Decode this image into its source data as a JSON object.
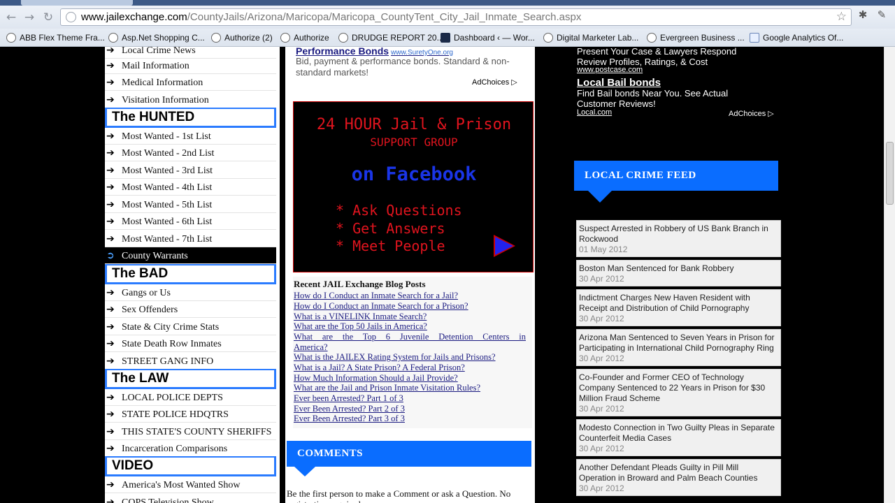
{
  "browser": {
    "url_domain": "www.jailexchange.com",
    "url_path": "/CountyJails/Arizona/Maricopa/Maricopa_CountyTent_City_Jail_Inmate_Search.aspx",
    "bookmarks": [
      {
        "label": "ABB Flex Theme Fra...",
        "icon": "circle-icon"
      },
      {
        "label": "Asp.Net Shopping C...",
        "icon": "circle-icon"
      },
      {
        "label": "Authorize (2)",
        "icon": "circle-icon"
      },
      {
        "label": "Authorize",
        "icon": "circle-icon"
      },
      {
        "label": "DRUDGE REPORT 20...",
        "icon": "circle-icon"
      },
      {
        "label": "Dashboard ‹ — Wor...",
        "icon": "x-square-icon"
      },
      {
        "label": "Digital Marketer Lab...",
        "icon": "circle-icon"
      },
      {
        "label": "Evergreen Business ...",
        "icon": "circle-icon"
      },
      {
        "label": "Google Analytics Of...",
        "icon": "chart-icon"
      }
    ]
  },
  "leftnav": {
    "items_top": [
      "Local Crime News",
      "Mail Information",
      "Medical Information",
      "Visitation Information"
    ],
    "hunted_title": "The HUNTED",
    "hunted_items": [
      "Most Wanted - 1st List",
      "Most Wanted - 2nd List",
      "Most Wanted - 3rd List",
      "Most Wanted - 4th List",
      "Most Wanted - 5th List",
      "Most Wanted - 6th List",
      "Most Wanted - 7th List"
    ],
    "county_warrants": "County Warrants",
    "bad_title": "The BAD",
    "bad_items": [
      "Gangs or Us",
      "Sex Offenders",
      "State & City Crime Stats",
      "State Death Row Inmates",
      "STREET GANG INFO"
    ],
    "law_title": "The LAW",
    "law_items": [
      "LOCAL POLICE DEPTS",
      "STATE POLICE HDQTRS",
      "THIS STATE'S COUNTY SHERIFFS",
      "Incarceration Comparisons"
    ],
    "video_title": "VIDEO",
    "video_items": [
      "America's Most Wanted Show",
      "COPS Television Show"
    ]
  },
  "middle": {
    "ad_title": "Performance Bonds",
    "ad_url": "www.SuretyOne.org",
    "ad_text": "Bid, payment & performance bonds. Standard & non-standard markets!",
    "adchoices": "AdChoices",
    "fb_line1": "24 HOUR Jail & Prison",
    "fb_line2": "SUPPORT GROUP",
    "fb_line3": "on Facebook",
    "fb_bullets": [
      "* Ask Questions",
      "* Get Answers",
      "* Meet People"
    ],
    "blog_heading": "Recent JAIL Exchange Blog Posts",
    "blog_links": [
      "How do I Conduct an Inmate Search for a Jail?",
      "How do I Conduct an Inmate Search for a Prison?",
      "What is a VINELINK Inmate Search?",
      "What are the Top 50 Jails in America?",
      "What are the Top 6 Juvenile Detention Centers in",
      "America?",
      "What is the JAILEX Rating System for Jails and Prisons?",
      "What is a Jail? A State Prison? A Federal Prison?",
      "How Much Information Should a Jail Provide?",
      "What are the Jail and Prison Inmate Visitation Rules?",
      "Ever been Arrested? Part 1 of 3",
      "Ever Been Arrested? Part 2 of 3",
      "Ever Been Arrested? Part 3 of 3"
    ],
    "comments_title": "COMMENTS",
    "comments_text": "Be the first person to make a Comment or ask a Question. No registration required."
  },
  "right": {
    "ad1_text": "Present Your Case & Lawyers Respond Review Profiles, Ratings, & Cost",
    "ad1_url": "www.postcase.com",
    "ad2_title": "Local Bail bonds",
    "ad2_text": "Find Bail bonds Near You. See Actual Customer Reviews!",
    "ad2_url": "Local.com",
    "adchoices": "AdChoices",
    "feed_title": "LOCAL CRIME FEED",
    "feed": [
      {
        "title": "Suspect Arrested in Robbery of US Bank Branch in Rockwood",
        "date": "01 May 2012"
      },
      {
        "title": "Boston Man Sentenced for Bank Robbery",
        "date": "30 Apr 2012"
      },
      {
        "title": "Indictment Charges New Haven Resident with Receipt and Distribution of Child Pornography",
        "date": "30 Apr 2012"
      },
      {
        "title": "Arizona Man Sentenced to Seven Years in Prison for Participating in International Child Pornography Ring",
        "date": "30 Apr 2012"
      },
      {
        "title": "Co-Founder and Former CEO of Technology Company Sentenced to 22 Years in Prison for $30 Million Fraud Scheme",
        "date": "30 Apr 2012"
      },
      {
        "title": "Modesto Connection in Two Guilty Pleas in Separate Counterfeit Media Cases",
        "date": "30 Apr 2012"
      },
      {
        "title": "Another Defendant Pleads Guilty in Pill Mill Operation in Broward and Palm Beach Counties",
        "date": "30 Apr 2012"
      }
    ]
  },
  "colors": {
    "accent_blue": "#0a6dff",
    "nav_border_blue": "#2a7bff",
    "fb_red": "#e0141e",
    "fb_blue": "#1a35e8"
  }
}
